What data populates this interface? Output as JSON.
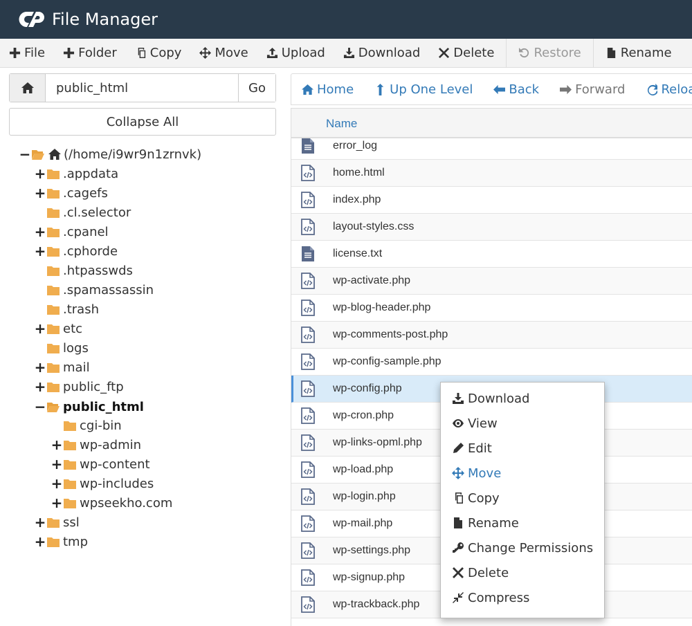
{
  "header": {
    "title": "File Manager"
  },
  "toolbar": {
    "items": [
      {
        "label": "File",
        "icon": "plus-icon"
      },
      {
        "label": "Folder",
        "icon": "plus-icon"
      },
      {
        "label": "Copy",
        "icon": "copy-icon"
      },
      {
        "label": "Move",
        "icon": "move-icon"
      },
      {
        "label": "Upload",
        "icon": "upload-icon"
      },
      {
        "label": "Download",
        "icon": "download-icon"
      },
      {
        "label": "Delete",
        "icon": "close-icon"
      },
      {
        "label": "Restore",
        "icon": "undo-icon",
        "disabled": true
      },
      {
        "label": "Rename",
        "icon": "file-icon"
      }
    ]
  },
  "path": {
    "value": "public_html",
    "go_label": "Go"
  },
  "collapse_label": "Collapse All",
  "tree": [
    {
      "label": "(/home/i9wr9n1zrnvk)",
      "toggle": "−",
      "home": true
    },
    {
      "label": ".appdata",
      "toggle": "+"
    },
    {
      "label": ".cagefs",
      "toggle": "+"
    },
    {
      "label": ".cl.selector",
      "toggle": ""
    },
    {
      "label": ".cpanel",
      "toggle": "+"
    },
    {
      "label": ".cphorde",
      "toggle": "+"
    },
    {
      "label": ".htpasswds",
      "toggle": ""
    },
    {
      "label": ".spamassassin",
      "toggle": ""
    },
    {
      "label": ".trash",
      "toggle": ""
    },
    {
      "label": "etc",
      "toggle": "+"
    },
    {
      "label": "logs",
      "toggle": ""
    },
    {
      "label": "mail",
      "toggle": "+"
    },
    {
      "label": "public_ftp",
      "toggle": "+"
    },
    {
      "label": "public_html",
      "toggle": "−",
      "bold": true,
      "open": true
    },
    {
      "label": "cgi-bin",
      "toggle": ""
    },
    {
      "label": "wp-admin",
      "toggle": "+"
    },
    {
      "label": "wp-content",
      "toggle": "+"
    },
    {
      "label": "wp-includes",
      "toggle": "+"
    },
    {
      "label": "wpseekho.com",
      "toggle": "+"
    },
    {
      "label": "ssl",
      "toggle": "+"
    },
    {
      "label": "tmp",
      "toggle": "+"
    }
  ],
  "nav": {
    "items": [
      {
        "label": "Home",
        "icon": "home-icon"
      },
      {
        "label": "Up One Level",
        "icon": "arrow-up-icon"
      },
      {
        "label": "Back",
        "icon": "arrow-left-icon"
      },
      {
        "label": "Forward",
        "icon": "arrow-right-icon",
        "disabled": true
      },
      {
        "label": "Reload",
        "icon": "refresh-icon"
      }
    ]
  },
  "list": {
    "column_name": "Name",
    "files": [
      {
        "name": "error_log",
        "type": "text"
      },
      {
        "name": "home.html",
        "type": "code"
      },
      {
        "name": "index.php",
        "type": "code"
      },
      {
        "name": "layout-styles.css",
        "type": "code"
      },
      {
        "name": "license.txt",
        "type": "text"
      },
      {
        "name": "wp-activate.php",
        "type": "code"
      },
      {
        "name": "wp-blog-header.php",
        "type": "code"
      },
      {
        "name": "wp-comments-post.php",
        "type": "code"
      },
      {
        "name": "wp-config-sample.php",
        "type": "code"
      },
      {
        "name": "wp-config.php",
        "type": "code",
        "selected": true
      },
      {
        "name": "wp-cron.php",
        "type": "code"
      },
      {
        "name": "wp-links-opml.php",
        "type": "code"
      },
      {
        "name": "wp-load.php",
        "type": "code"
      },
      {
        "name": "wp-login.php",
        "type": "code"
      },
      {
        "name": "wp-mail.php",
        "type": "code"
      },
      {
        "name": "wp-settings.php",
        "type": "code"
      },
      {
        "name": "wp-signup.php",
        "type": "code"
      },
      {
        "name": "wp-trackback.php",
        "type": "code"
      }
    ]
  },
  "context_menu": {
    "items": [
      {
        "label": "Download",
        "icon": "download-icon"
      },
      {
        "label": "View",
        "icon": "eye-icon"
      },
      {
        "label": "Edit",
        "icon": "pencil-icon"
      },
      {
        "label": "Move",
        "icon": "move-icon",
        "hover": true
      },
      {
        "label": "Copy",
        "icon": "copy-icon"
      },
      {
        "label": "Rename",
        "icon": "file-icon"
      },
      {
        "label": "Change Permissions",
        "icon": "key-icon"
      },
      {
        "label": "Delete",
        "icon": "close-icon"
      },
      {
        "label": "Compress",
        "icon": "compress-icon"
      }
    ]
  },
  "colors": {
    "header_bg": "#293a4a",
    "link": "#337ab7",
    "folder": "#f0ad4e",
    "file_icon": "#5a6a8a",
    "selected_row": "#d9ebf9"
  }
}
